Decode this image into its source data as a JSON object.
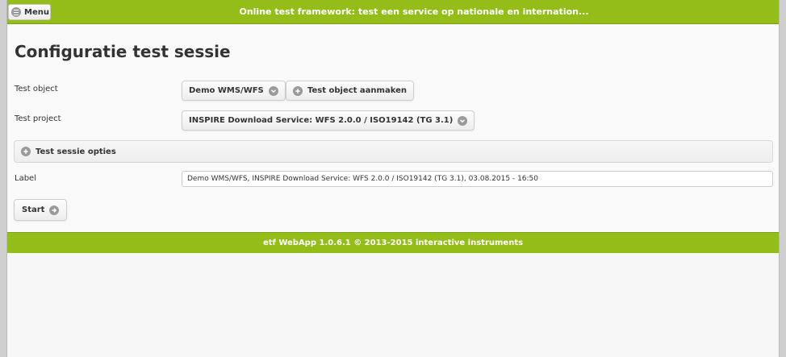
{
  "header": {
    "menu_label": "Menu",
    "title": "Online test framework: test een service op nationale en internation..."
  },
  "page": {
    "title": "Configuratie test sessie"
  },
  "form": {
    "test_object": {
      "label": "Test object",
      "selected": "Demo WMS/WFS",
      "create_button": "Test object aanmaken"
    },
    "test_project": {
      "label": "Test project",
      "selected": "INSPIRE Download Service: WFS 2.0.0 / ISO19142 (TG 3.1)"
    },
    "options": {
      "label": "Test sessie opties"
    },
    "label_field": {
      "label": "Label",
      "value": "Demo WMS/WFS, INSPIRE Download Service: WFS 2.0.0 / ISO19142 (TG 3.1), 03.08.2015 - 16:50"
    },
    "start_button": "Start"
  },
  "footer": {
    "text": "etf WebApp 1.0.6.1 © 2013-2015 interactive instruments"
  },
  "colors": {
    "brand_green": "#95bd1a",
    "icon_gray": "#9a9a9a"
  },
  "icons": {
    "menu": "menu-bars-icon",
    "dropdown": "chevron-down-circle-icon",
    "add": "plus-circle-icon",
    "start": "arrow-right-circle-icon"
  }
}
